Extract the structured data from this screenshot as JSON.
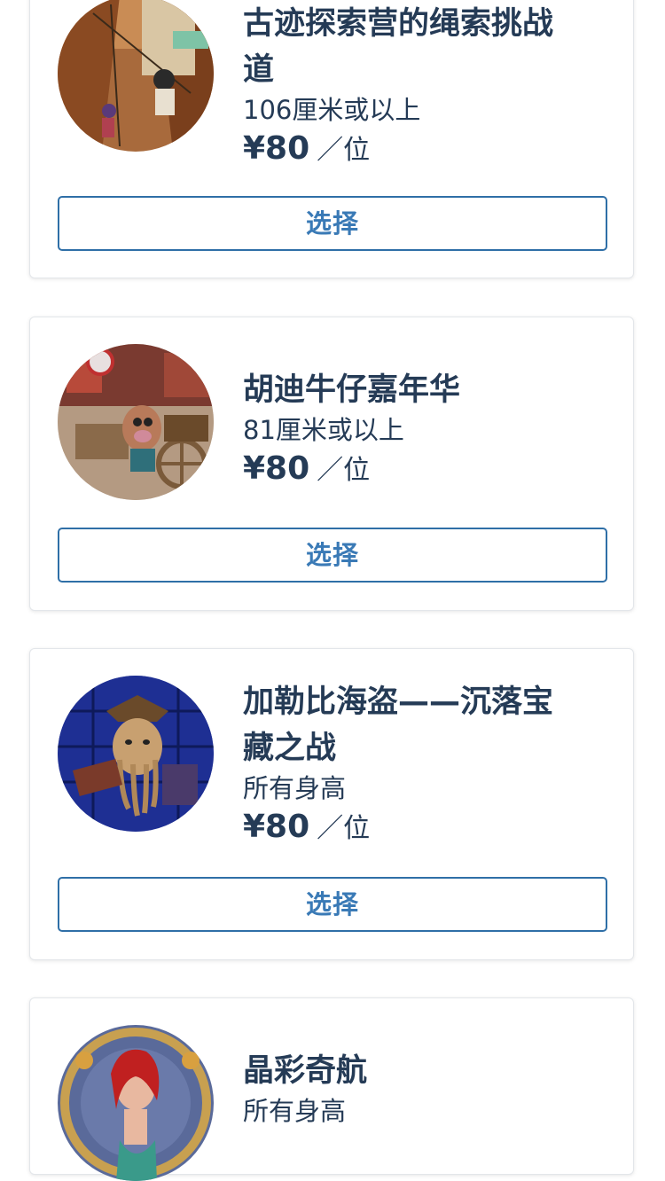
{
  "items": [
    {
      "title_line1": "古迹探索营的绳索挑战",
      "title_line2": "道",
      "height": "106厘米或以上",
      "price": "¥80",
      "unit": "／位",
      "button": "选择",
      "image": "rope-challenge-photo"
    },
    {
      "title_line1": "胡迪牛仔嘉年华",
      "height": "81厘米或以上",
      "price": "¥80",
      "unit": "／位",
      "button": "选择",
      "image": "woody-roundup-photo"
    },
    {
      "title_line1": "加勒比海盗——沉落宝",
      "title_line2": "藏之战",
      "height": "所有身高",
      "price": "¥80",
      "unit": "／位",
      "button": "选择",
      "image": "pirates-photo"
    },
    {
      "title_line1": "晶彩奇航",
      "height": "所有身高",
      "image": "voyage-to-crystal-grotto-photo"
    }
  ]
}
